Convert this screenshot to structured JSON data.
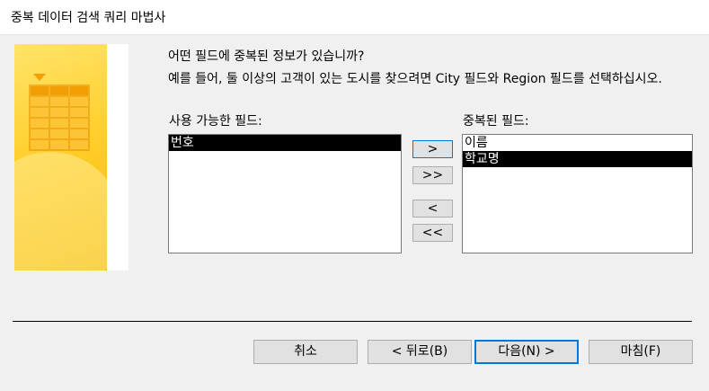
{
  "window": {
    "title": "중복 데이터 검색 쿼리 마법사"
  },
  "prompt": {
    "question": "어떤 필드에 중복된 정보가 있습니까?",
    "example": "예를 들어, 둘 이상의 고객이 있는 도시를 찾으려면 City 필드와 Region 필드를 선택하십시오."
  },
  "available": {
    "label": "사용 가능한 필드:",
    "items": [
      "번호"
    ]
  },
  "selected": {
    "label": "중복된 필드:",
    "items": [
      "이름",
      "학교명"
    ]
  },
  "move_buttons": {
    "add_one": ">",
    "add_all": ">>",
    "remove_one": "<",
    "remove_all": "<<"
  },
  "footer": {
    "cancel": "취소",
    "back": "< 뒤로(B)",
    "next": "다음(N) >",
    "finish": "마침(F)"
  },
  "colors": {
    "accent": "#0078d7",
    "selection": "#000000",
    "art": "#ffcf2e"
  }
}
